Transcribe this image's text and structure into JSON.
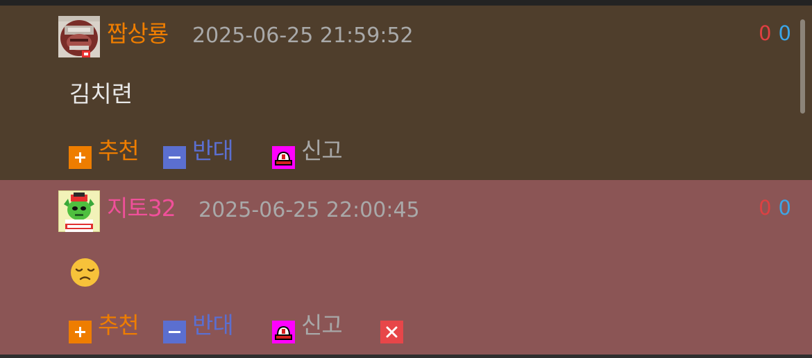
{
  "comments": [
    {
      "nickname": "짭상룡",
      "nickname_color": "#ee7d00",
      "avatar_icon": "mustache-man-avatar-icon",
      "datetime": "2025-06-25 21:59:52",
      "score_up": "0",
      "score_down": "0",
      "body": "김치련",
      "actions": {
        "recommend": "추천",
        "oppose": "반대",
        "report": "신고"
      }
    },
    {
      "nickname": "지토32",
      "nickname_color": "#f0509a",
      "avatar_icon": "green-goblin-avatar-icon",
      "datetime": "2025-06-25 22:00:45",
      "score_up": "0",
      "score_down": "0",
      "body_emoji": "disappointed-face-emoji",
      "actions": {
        "recommend": "추천",
        "oppose": "반대",
        "report": "신고",
        "delete_icon": "delete-x-icon"
      }
    }
  ],
  "colors": {
    "comment1_bg": "#4f3e2c",
    "comment2_bg": "#8b5555",
    "recommend": "#ee7d00",
    "oppose": "#5b6fd0",
    "report_icon": "#ff00ff",
    "delete": "#e74649",
    "score_up": "#e04040",
    "score_down": "#3aa6e8"
  }
}
